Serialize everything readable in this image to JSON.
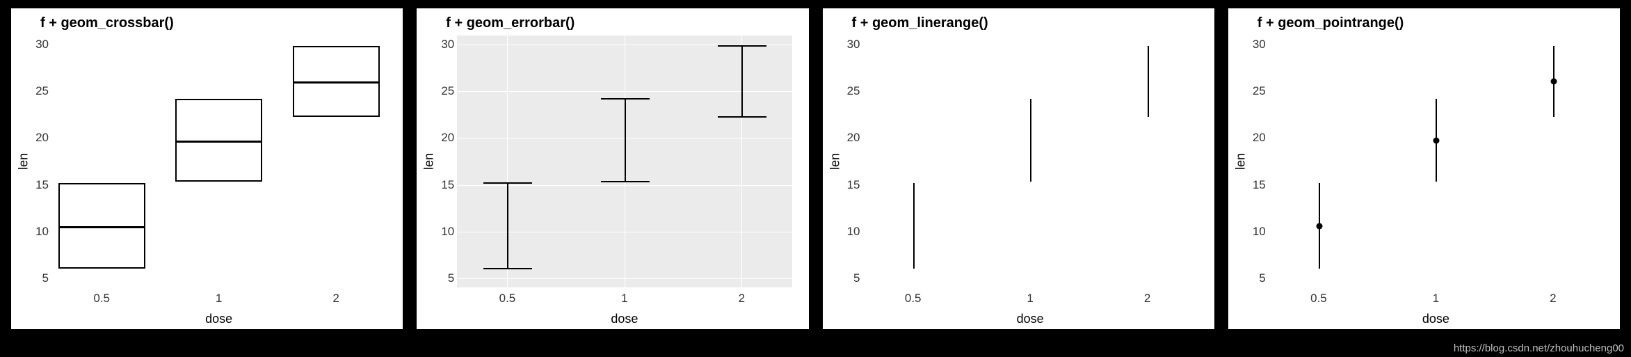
{
  "attribution": "https://blog.csdn.net/zhouhucheng00",
  "shared": {
    "xlabel": "dose",
    "ylabel": "len",
    "x_categories": [
      "0.5",
      "1",
      "2"
    ],
    "y_ticks": [
      5,
      10,
      15,
      20,
      25,
      30
    ],
    "ylim": [
      4,
      31
    ]
  },
  "chart_data": [
    {
      "title": "f + geom_crossbar()",
      "type": "crossbar",
      "theme": "white",
      "series": [
        {
          "x": "0.5",
          "ymin": 6.0,
          "y": 10.6,
          "ymax": 15.2
        },
        {
          "x": "1",
          "ymin": 15.3,
          "y": 19.7,
          "ymax": 24.2
        },
        {
          "x": "2",
          "ymin": 22.3,
          "y": 26.1,
          "ymax": 29.9
        }
      ]
    },
    {
      "title": "f + geom_errorbar()",
      "type": "errorbar",
      "theme": "gray",
      "series": [
        {
          "x": "0.5",
          "ymin": 6.0,
          "y": 10.6,
          "ymax": 15.2
        },
        {
          "x": "1",
          "ymin": 15.3,
          "y": 19.7,
          "ymax": 24.2
        },
        {
          "x": "2",
          "ymin": 22.3,
          "y": 26.1,
          "ymax": 29.9
        }
      ]
    },
    {
      "title": "f + geom_linerange()",
      "type": "linerange",
      "theme": "white",
      "series": [
        {
          "x": "0.5",
          "ymin": 6.0,
          "y": 10.6,
          "ymax": 15.2
        },
        {
          "x": "1",
          "ymin": 15.3,
          "y": 19.7,
          "ymax": 24.2
        },
        {
          "x": "2",
          "ymin": 22.3,
          "y": 26.1,
          "ymax": 29.9
        }
      ]
    },
    {
      "title": "f + geom_pointrange()",
      "type": "pointrange",
      "theme": "white",
      "series": [
        {
          "x": "0.5",
          "ymin": 6.0,
          "y": 10.6,
          "ymax": 15.2
        },
        {
          "x": "1",
          "ymin": 15.3,
          "y": 19.7,
          "ymax": 24.2
        },
        {
          "x": "2",
          "ymin": 22.3,
          "y": 26.1,
          "ymax": 29.9
        }
      ]
    }
  ]
}
